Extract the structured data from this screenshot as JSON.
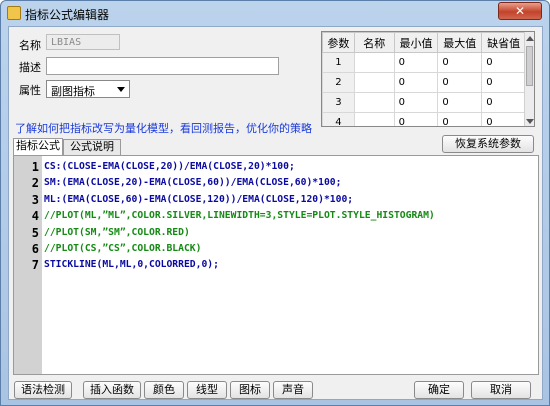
{
  "window": {
    "title": "指标公式编辑器",
    "close_glyph": "✕"
  },
  "form": {
    "name_label": "名称",
    "name_value": "LBIAS",
    "desc_label": "描述",
    "desc_value": "",
    "attr_label": "属性",
    "attr_value": "副图指标"
  },
  "params": {
    "headers": [
      "参数",
      "名称",
      "最小值",
      "最大值",
      "缺省值"
    ],
    "rows": [
      [
        "1",
        "",
        "0",
        "0",
        "0"
      ],
      [
        "2",
        "",
        "0",
        "0",
        "0"
      ],
      [
        "3",
        "",
        "0",
        "0",
        "0"
      ],
      [
        "4",
        "",
        "0",
        "0",
        "0"
      ]
    ]
  },
  "link_text": "了解如何把指标改写为量化模型，看回测报告，优化你的策略",
  "restore_button": "恢复系统参数",
  "tabs": [
    "指标公式",
    "公式说明"
  ],
  "code_lines": [
    {
      "num": "1",
      "text": "CS:(CLOSE-EMA(CLOSE,20))/EMA(CLOSE,20)*100;",
      "kind": "code"
    },
    {
      "num": "2",
      "text": "SM:(EMA(CLOSE,20)-EMA(CLOSE,60))/EMA(CLOSE,60)*100;",
      "kind": "code"
    },
    {
      "num": "3",
      "text": "ML:(EMA(CLOSE,60)-EMA(CLOSE,120))/EMA(CLOSE,120)*100;",
      "kind": "code"
    },
    {
      "num": "4",
      "text": "//PLOT(ML,”ML”,COLOR.SILVER,LINEWIDTH=3,STYLE=PLOT.STYLE_HISTOGRAM)",
      "kind": "comment"
    },
    {
      "num": "5",
      "text": "//PLOT(SM,”SM”,COLOR.RED)",
      "kind": "comment"
    },
    {
      "num": "6",
      "text": "//PLOT(CS,”CS”,COLOR.BLACK)",
      "kind": "comment"
    },
    {
      "num": "7",
      "text": "STICKLINE(ML,ML,0,COLORRED,0);",
      "kind": "code"
    }
  ],
  "buttons": {
    "syntax": "语法检测",
    "insert_func": "插入函数",
    "color": "颜色",
    "line_type": "线型",
    "icon": "图标",
    "sound": "声音",
    "ok": "确定",
    "cancel": "取消"
  },
  "colors": {
    "keyword": "#0a0aa0",
    "comment": "#148a14",
    "link": "#1a3adb"
  }
}
